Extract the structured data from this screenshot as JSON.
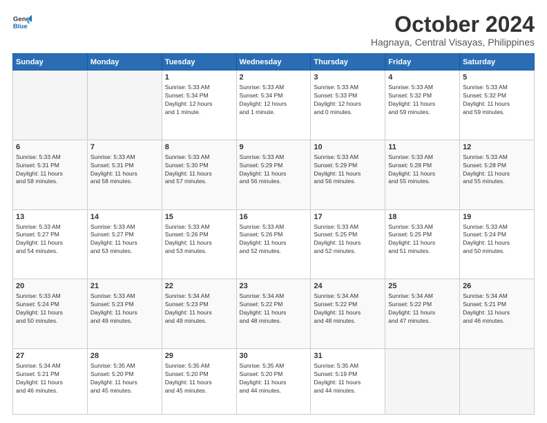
{
  "header": {
    "logo_line1": "General",
    "logo_line2": "Blue",
    "month": "October 2024",
    "location": "Hagnaya, Central Visayas, Philippines"
  },
  "weekdays": [
    "Sunday",
    "Monday",
    "Tuesday",
    "Wednesday",
    "Thursday",
    "Friday",
    "Saturday"
  ],
  "weeks": [
    [
      {
        "day": "",
        "info": ""
      },
      {
        "day": "",
        "info": ""
      },
      {
        "day": "1",
        "info": "Sunrise: 5:33 AM\nSunset: 5:34 PM\nDaylight: 12 hours\nand 1 minute."
      },
      {
        "day": "2",
        "info": "Sunrise: 5:33 AM\nSunset: 5:34 PM\nDaylight: 12 hours\nand 1 minute."
      },
      {
        "day": "3",
        "info": "Sunrise: 5:33 AM\nSunset: 5:33 PM\nDaylight: 12 hours\nand 0 minutes."
      },
      {
        "day": "4",
        "info": "Sunrise: 5:33 AM\nSunset: 5:32 PM\nDaylight: 11 hours\nand 59 minutes."
      },
      {
        "day": "5",
        "info": "Sunrise: 5:33 AM\nSunset: 5:32 PM\nDaylight: 11 hours\nand 59 minutes."
      }
    ],
    [
      {
        "day": "6",
        "info": "Sunrise: 5:33 AM\nSunset: 5:31 PM\nDaylight: 11 hours\nand 58 minutes."
      },
      {
        "day": "7",
        "info": "Sunrise: 5:33 AM\nSunset: 5:31 PM\nDaylight: 11 hours\nand 58 minutes."
      },
      {
        "day": "8",
        "info": "Sunrise: 5:33 AM\nSunset: 5:30 PM\nDaylight: 11 hours\nand 57 minutes."
      },
      {
        "day": "9",
        "info": "Sunrise: 5:33 AM\nSunset: 5:29 PM\nDaylight: 11 hours\nand 56 minutes."
      },
      {
        "day": "10",
        "info": "Sunrise: 5:33 AM\nSunset: 5:29 PM\nDaylight: 11 hours\nand 56 minutes."
      },
      {
        "day": "11",
        "info": "Sunrise: 5:33 AM\nSunset: 5:28 PM\nDaylight: 11 hours\nand 55 minutes."
      },
      {
        "day": "12",
        "info": "Sunrise: 5:33 AM\nSunset: 5:28 PM\nDaylight: 11 hours\nand 55 minutes."
      }
    ],
    [
      {
        "day": "13",
        "info": "Sunrise: 5:33 AM\nSunset: 5:27 PM\nDaylight: 11 hours\nand 54 minutes."
      },
      {
        "day": "14",
        "info": "Sunrise: 5:33 AM\nSunset: 5:27 PM\nDaylight: 11 hours\nand 53 minutes."
      },
      {
        "day": "15",
        "info": "Sunrise: 5:33 AM\nSunset: 5:26 PM\nDaylight: 11 hours\nand 53 minutes."
      },
      {
        "day": "16",
        "info": "Sunrise: 5:33 AM\nSunset: 5:26 PM\nDaylight: 11 hours\nand 52 minutes."
      },
      {
        "day": "17",
        "info": "Sunrise: 5:33 AM\nSunset: 5:25 PM\nDaylight: 11 hours\nand 52 minutes."
      },
      {
        "day": "18",
        "info": "Sunrise: 5:33 AM\nSunset: 5:25 PM\nDaylight: 11 hours\nand 51 minutes."
      },
      {
        "day": "19",
        "info": "Sunrise: 5:33 AM\nSunset: 5:24 PM\nDaylight: 11 hours\nand 50 minutes."
      }
    ],
    [
      {
        "day": "20",
        "info": "Sunrise: 5:33 AM\nSunset: 5:24 PM\nDaylight: 11 hours\nand 50 minutes."
      },
      {
        "day": "21",
        "info": "Sunrise: 5:33 AM\nSunset: 5:23 PM\nDaylight: 11 hours\nand 49 minutes."
      },
      {
        "day": "22",
        "info": "Sunrise: 5:34 AM\nSunset: 5:23 PM\nDaylight: 11 hours\nand 49 minutes."
      },
      {
        "day": "23",
        "info": "Sunrise: 5:34 AM\nSunset: 5:22 PM\nDaylight: 11 hours\nand 48 minutes."
      },
      {
        "day": "24",
        "info": "Sunrise: 5:34 AM\nSunset: 5:22 PM\nDaylight: 11 hours\nand 48 minutes."
      },
      {
        "day": "25",
        "info": "Sunrise: 5:34 AM\nSunset: 5:22 PM\nDaylight: 11 hours\nand 47 minutes."
      },
      {
        "day": "26",
        "info": "Sunrise: 5:34 AM\nSunset: 5:21 PM\nDaylight: 11 hours\nand 46 minutes."
      }
    ],
    [
      {
        "day": "27",
        "info": "Sunrise: 5:34 AM\nSunset: 5:21 PM\nDaylight: 11 hours\nand 46 minutes."
      },
      {
        "day": "28",
        "info": "Sunrise: 5:35 AM\nSunset: 5:20 PM\nDaylight: 11 hours\nand 45 minutes."
      },
      {
        "day": "29",
        "info": "Sunrise: 5:35 AM\nSunset: 5:20 PM\nDaylight: 11 hours\nand 45 minutes."
      },
      {
        "day": "30",
        "info": "Sunrise: 5:35 AM\nSunset: 5:20 PM\nDaylight: 11 hours\nand 44 minutes."
      },
      {
        "day": "31",
        "info": "Sunrise: 5:35 AM\nSunset: 5:19 PM\nDaylight: 11 hours\nand 44 minutes."
      },
      {
        "day": "",
        "info": ""
      },
      {
        "day": "",
        "info": ""
      }
    ]
  ]
}
